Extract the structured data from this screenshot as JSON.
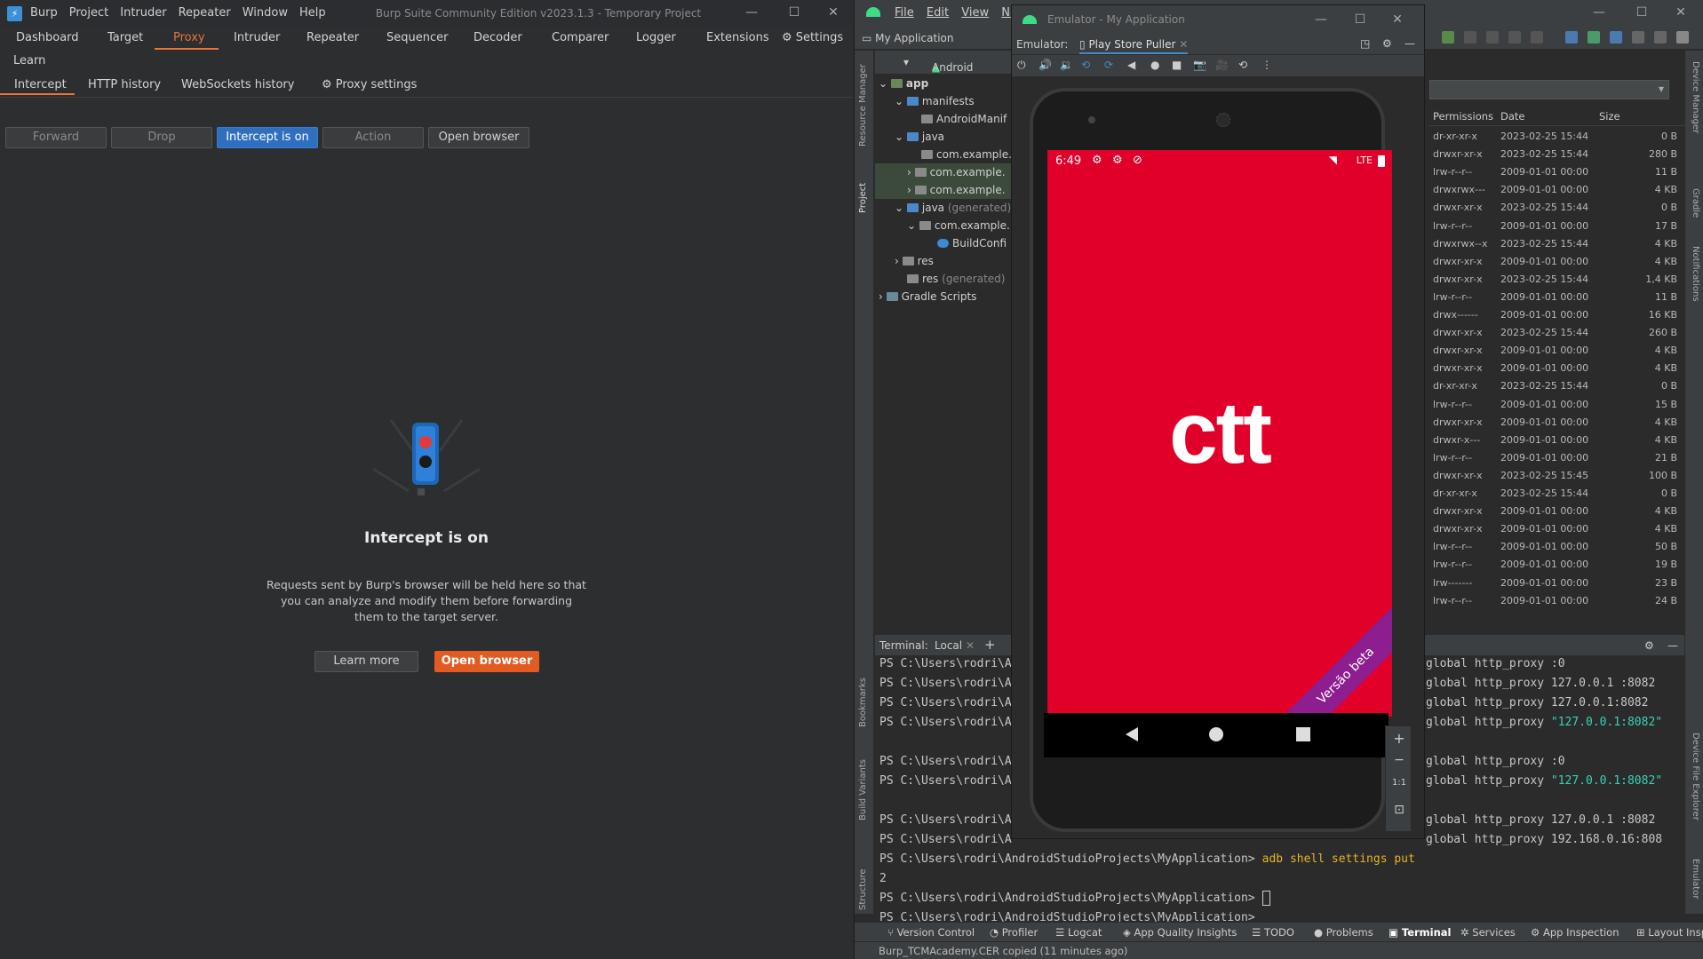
{
  "burp": {
    "menu": [
      "Burp",
      "Project",
      "Intruder",
      "Repeater",
      "Window",
      "Help"
    ],
    "title": "Burp Suite Community Edition v2023.1.3 - Temporary Project",
    "tabs": [
      "Dashboard",
      "Target",
      "Proxy",
      "Intruder",
      "Repeater",
      "Sequencer",
      "Decoder",
      "Comparer",
      "Logger",
      "Extensions"
    ],
    "settings_label": "Settings",
    "learn_label": "Learn",
    "subtabs": [
      "Intercept",
      "HTTP history",
      "WebSockets history"
    ],
    "proxy_settings_label": "Proxy settings",
    "buttons": {
      "forward": "Forward",
      "drop": "Drop",
      "intercept": "Intercept is on",
      "action": "Action",
      "open_browser": "Open browser"
    },
    "empty": {
      "title": "Intercept is on",
      "desc": "Requests sent by Burp's browser will be held here so that you can analyze and modify them before forwarding them to the target server.",
      "learn_more": "Learn more",
      "open_browser": "Open browser"
    }
  },
  "studio": {
    "menu": [
      "File",
      "Edit",
      "View",
      "Navig"
    ],
    "breadcrumb": "My Application",
    "project_view": "Android",
    "left_tools": [
      "Resource Manager",
      "Project",
      "Bookmarks",
      "Build Variants",
      "Structure"
    ],
    "right_tools": [
      "Device Manager",
      "Gradle",
      "Notifications",
      "Device File Explorer",
      "Emulator"
    ],
    "tree": [
      {
        "label": "app",
        "indent": 1
      },
      {
        "label": "manifests",
        "indent": 2
      },
      {
        "label": "AndroidManif",
        "indent": 3
      },
      {
        "label": "java",
        "indent": 2
      },
      {
        "label": "com.example.",
        "indent": 3
      },
      {
        "label": "com.example.",
        "indent": 3
      },
      {
        "label": "com.example.",
        "indent": 3
      },
      {
        "label": "java",
        "suffix": "(generated)",
        "indent": 2
      },
      {
        "label": "com.example.",
        "indent": 3
      },
      {
        "label": "BuildConfi",
        "indent": 4
      },
      {
        "label": "res",
        "indent": 2
      },
      {
        "label": "res",
        "suffix": "(generated)",
        "indent": 2
      },
      {
        "label": "Gradle Scripts",
        "indent": 1
      }
    ],
    "files": {
      "columns": [
        "Permissions",
        "Date",
        "Size"
      ],
      "rows": [
        [
          "dr-xr-xr-x",
          "2023-02-25 15:44",
          "0 B"
        ],
        [
          "drwxr-xr-x",
          "2023-02-25 15:44",
          "280 B"
        ],
        [
          "lrw-r--r--",
          "2009-01-01 00:00",
          "11 B"
        ],
        [
          "drwxrwx---",
          "2009-01-01 00:00",
          "4 KB"
        ],
        [
          "drwxr-xr-x",
          "2023-02-25 15:44",
          "0 B"
        ],
        [
          "lrw-r--r--",
          "2009-01-01 00:00",
          "17 B"
        ],
        [
          "drwxrwx--x",
          "2023-02-25 15:44",
          "4 KB"
        ],
        [
          "drwxr-xr-x",
          "2009-01-01 00:00",
          "4 KB"
        ],
        [
          "drwxr-xr-x",
          "2023-02-25 15:44",
          "1,4 KB"
        ],
        [
          "lrw-r--r--",
          "2009-01-01 00:00",
          "11 B"
        ],
        [
          "drwx------",
          "2009-01-01 00:00",
          "16 KB"
        ],
        [
          "drwxr-xr-x",
          "2023-02-25 15:44",
          "260 B"
        ],
        [
          "drwxr-xr-x",
          "2009-01-01 00:00",
          "4 KB"
        ],
        [
          "drwxr-xr-x",
          "2009-01-01 00:00",
          "4 KB"
        ],
        [
          "dr-xr-xr-x",
          "2023-02-25 15:44",
          "0 B"
        ],
        [
          "lrw-r--r--",
          "2009-01-01 00:00",
          "15 B"
        ],
        [
          "drwxr-xr-x",
          "2009-01-01 00:00",
          "4 KB"
        ],
        [
          "drwxr-x---",
          "2009-01-01 00:00",
          "4 KB"
        ],
        [
          "lrw-r--r--",
          "2009-01-01 00:00",
          "21 B"
        ],
        [
          "drwxr-xr-x",
          "2023-02-25 15:45",
          "100 B"
        ],
        [
          "dr-xr-xr-x",
          "2023-02-25 15:44",
          "0 B"
        ],
        [
          "drwxr-xr-x",
          "2009-01-01 00:00",
          "4 KB"
        ],
        [
          "drwxr-xr-x",
          "2009-01-01 00:00",
          "4 KB"
        ],
        [
          "lrw-r--r--",
          "2009-01-01 00:00",
          "50 B"
        ],
        [
          "lrw-r--r--",
          "2009-01-01 00:00",
          "19 B"
        ],
        [
          "lrw-------",
          "2009-01-01 00:00",
          "23 B"
        ],
        [
          "lrw-r--r--",
          "2009-01-01 00:00",
          "24 B"
        ]
      ]
    },
    "terminal": {
      "label": "Terminal:",
      "tab": "Local",
      "prompt_short": "PS C:\\Users\\rodri\\A",
      "prompt_full": "PS C:\\Users\\rodri\\AndroidStudioProjects\\MyApplication>",
      "cmd_partial": "adb shell settings put",
      "line_two": "2",
      "right_lines": [
        {
          "text": "global http_proxy :0"
        },
        {
          "text": "global http_proxy 127.0.0.1 :8082"
        },
        {
          "text": "global http_proxy 127.0.0.1:8082"
        },
        {
          "pre": "global http_proxy ",
          "str": "\"127.0.0.1:8082\""
        },
        {
          "text": ""
        },
        {
          "text": "global http_proxy :0"
        },
        {
          "pre": "global http_proxy ",
          "str": "\"127.0.0.1:8082\""
        },
        {
          "text": ""
        },
        {
          "text": "global http_proxy 127.0.0.1 :8082"
        },
        {
          "text": "global http_proxy 192.168.0.16:808"
        }
      ]
    },
    "bottom_tabs": [
      "Version Control",
      "Profiler",
      "Logcat",
      "App Quality Insights",
      "TODO",
      "Problems",
      "Terminal",
      "Services",
      "App Inspection",
      "Layout Insp"
    ],
    "status": "Burp_TCMAcademy.CER copied (11 minutes ago)"
  },
  "emulator": {
    "title": "Emulator - My Application",
    "label": "Emulator:",
    "device_tab": "Play Store Puller",
    "time": "6:49",
    "network": "LTE",
    "app_logo": "ctt",
    "banner": "Versão beta",
    "zoom_ratio": "1:1"
  },
  "colors": {
    "burp_accent": "#e8743b",
    "intercept_on": "#2e6fbf",
    "open_browser": "#e15b23",
    "ctt_red": "#e1002a",
    "beta_purple": "#8e1e8f"
  }
}
